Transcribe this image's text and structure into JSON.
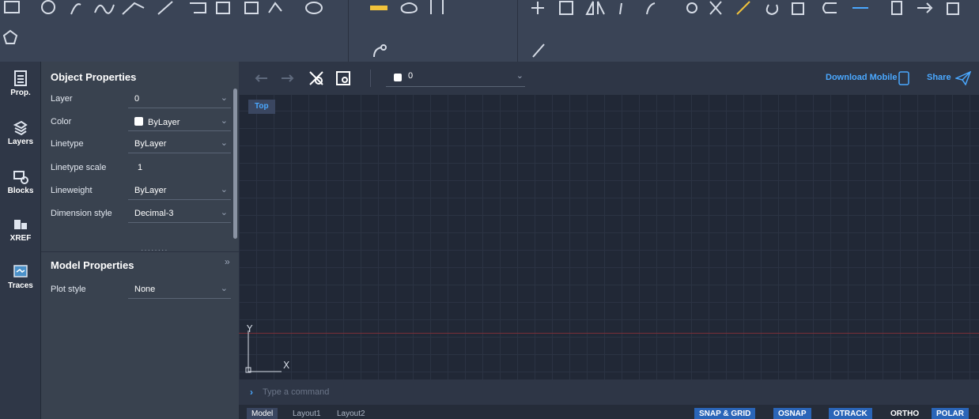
{
  "rail": {
    "items": [
      {
        "label": "Prop."
      },
      {
        "label": "Layers"
      },
      {
        "label": "Blocks"
      },
      {
        "label": "XREF"
      },
      {
        "label": "Traces"
      }
    ]
  },
  "object_properties": {
    "title": "Object Properties",
    "rows": [
      {
        "label": "Layer",
        "value": "0"
      },
      {
        "label": "Color",
        "value": "ByLayer"
      },
      {
        "label": "Linetype",
        "value": "ByLayer"
      },
      {
        "label": "Linetype scale",
        "value": "1"
      },
      {
        "label": "Lineweight",
        "value": "ByLayer"
      },
      {
        "label": "Dimension style",
        "value": "Decimal-3"
      }
    ]
  },
  "model_properties": {
    "title": "Model Properties",
    "rows": [
      {
        "label": "Plot style",
        "value": "None"
      }
    ]
  },
  "canvas": {
    "layer_value": "0",
    "download_mobile": "Download Mobile",
    "share": "Share",
    "view_label": "Top",
    "axis_y": "Y",
    "axis_x": "X",
    "command_placeholder": "Type a command"
  },
  "status": {
    "tabs": [
      "Model",
      "Layout1",
      "Layout2"
    ],
    "toggles": [
      "SNAP & GRID",
      "OSNAP",
      "OTRACK",
      "ORTHO",
      "POLAR"
    ]
  },
  "colors": {
    "accent": "#4aa8ff",
    "ucs_red_line": "#7a2f38"
  }
}
